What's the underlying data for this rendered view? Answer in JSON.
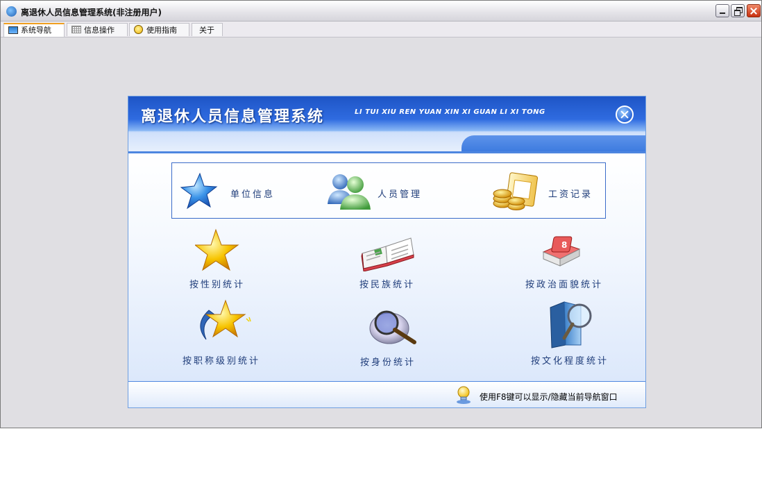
{
  "window": {
    "title": "离退休人员信息管理系统(非注册用户)"
  },
  "tabs": [
    {
      "label": "系统导航",
      "icon": "monitor-icon"
    },
    {
      "label": "信息操作",
      "icon": "grid-icon"
    },
    {
      "label": "使用指南",
      "icon": "help-icon"
    },
    {
      "label": "关于"
    }
  ],
  "panel": {
    "title": "离退休人员信息管理系统",
    "subtitle": "LI TUI XIU REN YUAN XIN XI GUAN LI XI TONG",
    "primary": [
      {
        "label": "单位信息",
        "icon": "blue-star-icon"
      },
      {
        "label": "人员管理",
        "icon": "users-icon"
      },
      {
        "label": "工资记录",
        "icon": "coins-icon"
      }
    ],
    "stats": [
      {
        "label": "按性别统计",
        "icon": "gold-star-icon"
      },
      {
        "label": "按民族统计",
        "icon": "open-book-icon"
      },
      {
        "label": "按政治面貌统计",
        "icon": "red-book-icon"
      },
      {
        "label": "按职称级别统计",
        "icon": "shooting-star-icon"
      },
      {
        "label": "按身份统计",
        "icon": "magnifier-disc-icon"
      },
      {
        "label": "按文化程度统计",
        "icon": "folder-search-icon"
      }
    ],
    "footer_tip": "使用F8键可以显示/隐藏当前导航窗口"
  },
  "colors": {
    "accent": "#2f6be0",
    "label_text": "#1f3d7a",
    "active_tab_border": "#f0a020"
  }
}
